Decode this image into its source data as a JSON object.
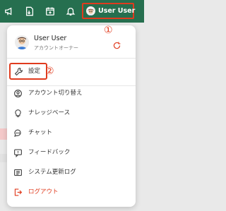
{
  "topbar": {
    "background": "#266f4f",
    "icons": [
      "megaphone-icon",
      "document-icon",
      "calendar-icon",
      "bell-icon"
    ],
    "user_button": {
      "label": "User User",
      "annotation": "①"
    }
  },
  "menu": {
    "profile": {
      "name": "User User",
      "role": "アカウントオーナー",
      "action_icon": "refresh-icon"
    },
    "items": [
      {
        "icon": "wrench-icon",
        "label": "設定"
      },
      {
        "icon": "switch-account-icon",
        "label": "アカウント切り替え"
      },
      {
        "icon": "lightbulb-icon",
        "label": "ナレッジベース"
      },
      {
        "icon": "chat-icon",
        "label": "チャット"
      },
      {
        "icon": "feedback-icon",
        "label": "フィードバック"
      },
      {
        "icon": "changelog-icon",
        "label": "システム更新ログ"
      },
      {
        "icon": "logout-icon",
        "label": "ログアウト"
      }
    ],
    "settings_annotation": "②"
  },
  "colors": {
    "accent": "#266f4f",
    "highlight": "#e03b1e",
    "logout": "#e03b1e"
  }
}
